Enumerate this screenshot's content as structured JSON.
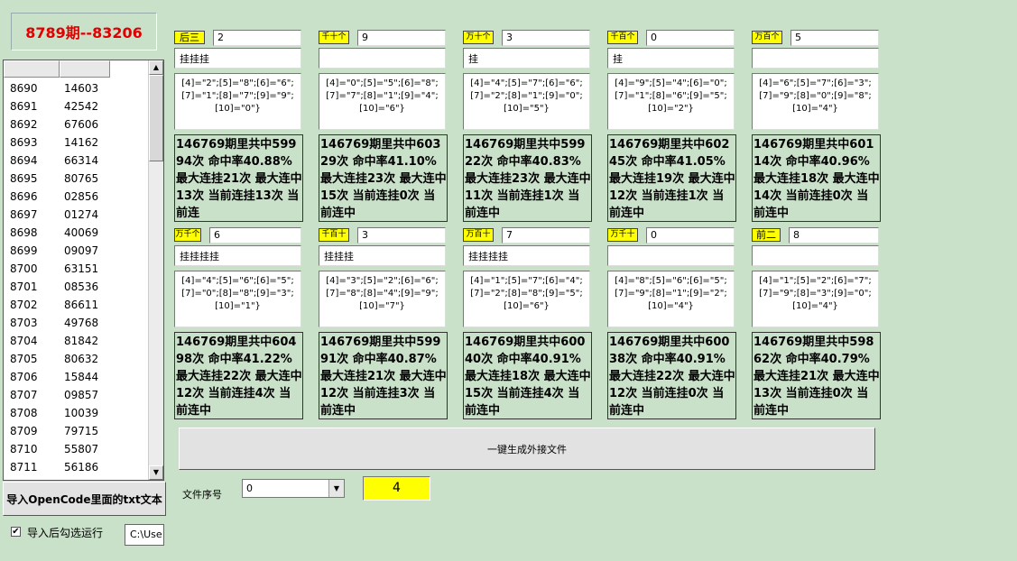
{
  "title": "8789期--83206",
  "list": {
    "rows": [
      {
        "issue": "8690",
        "code": "14603"
      },
      {
        "issue": "8691",
        "code": "42542"
      },
      {
        "issue": "8692",
        "code": "67606"
      },
      {
        "issue": "8693",
        "code": "14162"
      },
      {
        "issue": "8694",
        "code": "66314"
      },
      {
        "issue": "8695",
        "code": "80765"
      },
      {
        "issue": "8696",
        "code": "02856"
      },
      {
        "issue": "8697",
        "code": "01274"
      },
      {
        "issue": "8698",
        "code": "40069"
      },
      {
        "issue": "8699",
        "code": "09097"
      },
      {
        "issue": "8700",
        "code": "63151"
      },
      {
        "issue": "8701",
        "code": "08536"
      },
      {
        "issue": "8702",
        "code": "86611"
      },
      {
        "issue": "8703",
        "code": "49768"
      },
      {
        "issue": "8704",
        "code": "81842"
      },
      {
        "issue": "8705",
        "code": "80632"
      },
      {
        "issue": "8706",
        "code": "15844"
      },
      {
        "issue": "8707",
        "code": "09857"
      },
      {
        "issue": "8708",
        "code": "10039"
      },
      {
        "issue": "8709",
        "code": "79715"
      },
      {
        "issue": "8710",
        "code": "55807"
      },
      {
        "issue": "8711",
        "code": "56186"
      }
    ]
  },
  "import_button": "导入OpenCode里面的txt文本",
  "auto_run_label": "导入后勾选运行",
  "auto_run_checked": true,
  "path_value": "C:\\Use",
  "panels": [
    {
      "tag": "后三",
      "value": "2",
      "text": "挂挂挂",
      "codes": "[4]=\"2\";[5]=\"8\";[6]=\"6\";\n[7]=\"1\";[8]=\"7\";[9]=\"9\";\n[10]=\"0\"}",
      "stats": "146769期里共中59994次 命中率40.88% 最大连挂21次 最大连中13次 当前连挂13次 当前连"
    },
    {
      "tag": "千十个",
      "value": "9",
      "text": "",
      "codes": "[4]=\"0\";[5]=\"5\";[6]=\"8\";\n[7]=\"7\";[8]=\"1\";[9]=\"4\";\n[10]=\"6\"}",
      "stats": "146769期里共中60329次 命中率41.10% 最大连挂23次 最大连中15次 当前连挂0次 当前连中"
    },
    {
      "tag": "万十个",
      "value": "3",
      "text": "挂",
      "codes": "[4]=\"4\";[5]=\"7\";[6]=\"6\";\n[7]=\"2\";[8]=\"1\";[9]=\"0\";\n[10]=\"5\"}",
      "stats": "146769期里共中59922次 命中率40.83% 最大连挂23次 最大连中11次 当前连挂1次 当前连中"
    },
    {
      "tag": "千百个",
      "value": "0",
      "text": "挂",
      "codes": "[4]=\"9\";[5]=\"4\";[6]=\"0\";\n[7]=\"1\";[8]=\"6\";[9]=\"5\";\n[10]=\"2\"}",
      "stats": "146769期里共中60245次 命中率41.05% 最大连挂19次 最大连中12次 当前连挂1次 当前连中"
    },
    {
      "tag": "万百个",
      "value": "5",
      "text": "",
      "codes": "[4]=\"6\";[5]=\"7\";[6]=\"3\";\n[7]=\"9\";[8]=\"0\";[9]=\"8\";\n[10]=\"4\"}",
      "stats": "146769期里共中60114次 命中率40.96% 最大连挂18次 最大连中14次 当前连挂0次 当前连中"
    },
    {
      "tag": "万千个",
      "value": "6",
      "text": "挂挂挂挂",
      "codes": "[4]=\"4\";[5]=\"6\";[6]=\"5\";\n[7]=\"0\";[8]=\"8\";[9]=\"3\";\n[10]=\"1\"}",
      "stats": "146769期里共中60498次 命中率41.22% 最大连挂22次 最大连中12次 当前连挂4次 当前连中"
    },
    {
      "tag": "千百十",
      "value": "3",
      "text": "挂挂挂",
      "codes": "[4]=\"3\";[5]=\"2\";[6]=\"6\";\n[7]=\"8\";[8]=\"4\";[9]=\"9\";\n[10]=\"7\"}",
      "stats": "146769期里共中59991次 命中率40.87% 最大连挂21次 最大连中12次 当前连挂3次 当前连中"
    },
    {
      "tag": "万百十",
      "value": "7",
      "text": "挂挂挂挂",
      "codes": "[4]=\"1\";[5]=\"7\";[6]=\"4\";\n[7]=\"2\";[8]=\"8\";[9]=\"5\";\n[10]=\"6\"}",
      "stats": "146769期里共中60040次 命中率40.91% 最大连挂18次 最大连中15次 当前连挂4次 当前连中"
    },
    {
      "tag": "万千十",
      "value": "0",
      "text": "",
      "codes": "[4]=\"8\";[5]=\"6\";[6]=\"5\";\n[7]=\"9\";[8]=\"1\";[9]=\"2\";\n[10]=\"4\"}",
      "stats": "146769期里共中60038次 命中率40.91% 最大连挂22次 最大连中12次 当前连挂0次 当前连中"
    },
    {
      "tag": "前二",
      "value": "8",
      "text": "",
      "codes": "[4]=\"1\";[5]=\"2\";[6]=\"7\";\n[7]=\"9\";[8]=\"3\";[9]=\"0\";\n[10]=\"4\"}",
      "stats": "146769期里共中59862次 命中率40.79% 最大连挂21次 最大连中13次 当前连挂0次 当前连中"
    }
  ],
  "generate_button": "一键生成外接文件",
  "file_index_label": "文件序号",
  "file_index_value": "0",
  "count_value": "4",
  "colors": {
    "background": "#c9e0c9",
    "title": "#e00000",
    "tag": "#ffff00"
  }
}
